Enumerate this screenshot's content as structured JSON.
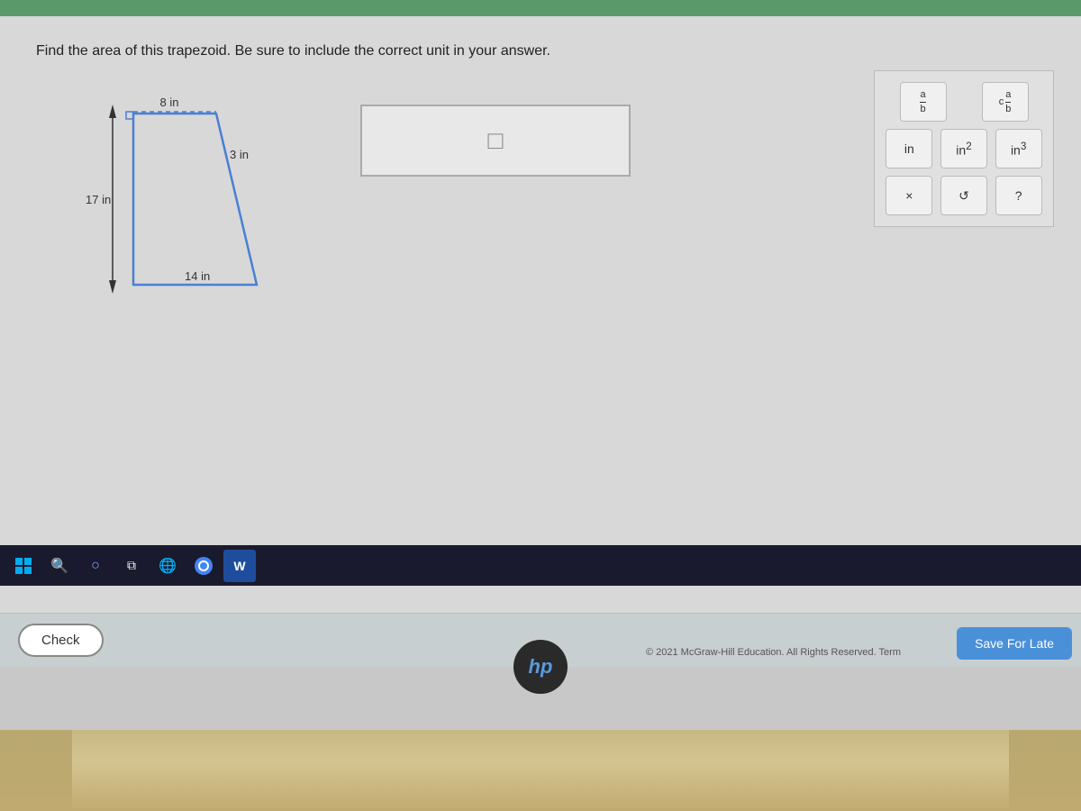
{
  "page": {
    "question": "Find the area of this trapezoid. Be sure to include the correct unit in your answer.",
    "diagram": {
      "label_top": "8 in",
      "label_right": "3 in",
      "label_left": "17 in",
      "label_bottom": "14 in"
    },
    "answer": {
      "placeholder": "",
      "value": ""
    },
    "keypad": {
      "row1": [
        "fraction",
        "mixed_fraction"
      ],
      "row2_labels": [
        "in",
        "in²",
        "in³"
      ],
      "row3_labels": [
        "×",
        "↺",
        "?"
      ]
    },
    "buttons": {
      "check": "Check",
      "save_for_late": "Save For Late"
    },
    "footer": {
      "copyright": "© 2021 McGraw-Hill Education. All Rights Reserved.  Term"
    }
  }
}
